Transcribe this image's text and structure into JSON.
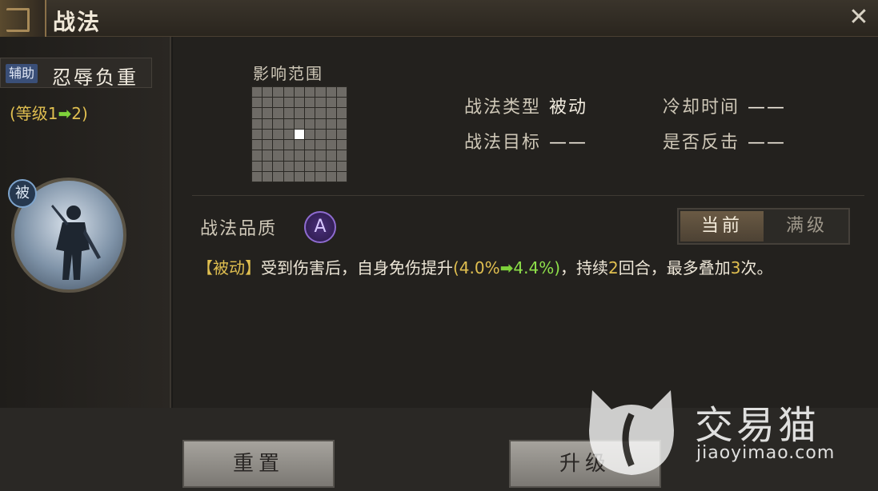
{
  "window": {
    "title": "战法",
    "close_icon": "close-icon"
  },
  "skill": {
    "tag": "辅助",
    "name": "忍辱负重",
    "level_prefix": "(等级1",
    "level_suffix": "2)",
    "passive_badge": "被"
  },
  "range": {
    "label": "影响范围",
    "grid_size": 9,
    "center_cell": [
      4,
      4
    ]
  },
  "info": {
    "type_key": "战法类型",
    "type_val": "被动",
    "cooldown_key": "冷却时间",
    "cooldown_val": "——",
    "target_key": "战法目标",
    "target_val": "——",
    "counter_key": "是否反击",
    "counter_val": "——"
  },
  "quality": {
    "label": "战法品质",
    "grade": "A"
  },
  "toggle": {
    "current": "当前",
    "max": "满级",
    "selected": "current"
  },
  "description": {
    "tag": "【被动】",
    "text1": "受到伤害后，自身免伤提升",
    "old": "(4.0%",
    "new": "4.4%)",
    "text2": "，持续",
    "rounds": "2",
    "text3": "回合，最多叠加",
    "stacks": "3",
    "text4": "次。"
  },
  "buttons": {
    "reset": "重置",
    "upgrade": "升级"
  },
  "watermark": {
    "cn": "交易猫",
    "en": "jiaoyimao.com"
  },
  "colors": {
    "gold": "#e0bf50",
    "green": "#8ee04a",
    "quality_purple": "#8e6bd0"
  }
}
